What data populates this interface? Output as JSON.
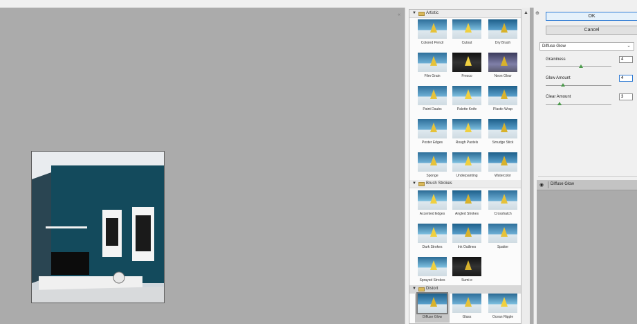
{
  "gallery": {
    "categories": [
      {
        "name": "Artistic",
        "filters": [
          "Colored Pencil",
          "Cutout",
          "Dry Brush",
          "Film Grain",
          "Fresco",
          "Neon Glow",
          "Paint Daubs",
          "Palette Knife",
          "Plastic Wrap",
          "Poster Edges",
          "Rough Pastels",
          "Smudge Stick",
          "Sponge",
          "Underpainting",
          "Watercolor"
        ]
      },
      {
        "name": "Brush Strokes",
        "filters": [
          "Accented Edges",
          "Angled Strokes",
          "Crosshatch",
          "Dark Strokes",
          "Ink Outlines",
          "Spatter",
          "Sprayed Strokes",
          "Sumi-e"
        ]
      },
      {
        "name": "Distort",
        "filters": [
          "Diffuse Glow",
          "Glass",
          "Ocean Ripple"
        ]
      }
    ],
    "selected_filter": "Diffuse Glow"
  },
  "panel": {
    "ok_label": "OK",
    "cancel_label": "Cancel",
    "filter_select": "Diffuse Glow",
    "params": [
      {
        "label": "Graininess",
        "value": "4"
      },
      {
        "label": "Glow Amount",
        "value": "4"
      },
      {
        "label": "Clear Amount",
        "value": "3"
      }
    ],
    "layer_name": "Diffuse Glow"
  },
  "icons": [
    "collapse-icon",
    "folder-icon",
    "disclosure-triangle-icon",
    "eye-icon",
    "chevron-down-icon"
  ]
}
